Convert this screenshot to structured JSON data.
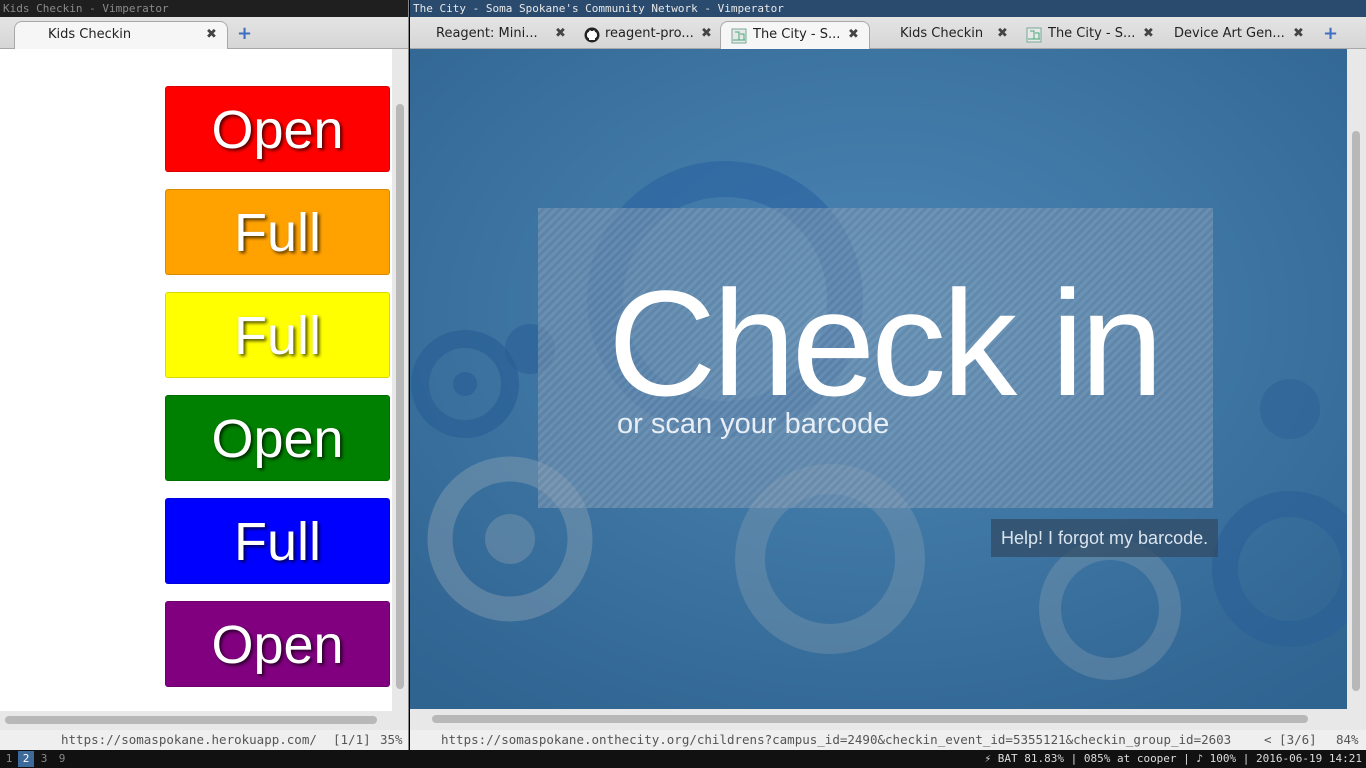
{
  "left_window": {
    "title": "Kids Checkin - Vimperator",
    "tabs": [
      {
        "label": "Kids Checkin"
      }
    ],
    "new_tab": "+",
    "close_glyph": "✖",
    "buttons": [
      {
        "label": "Open",
        "color": "#ff0000"
      },
      {
        "label": "Full",
        "color": "#ffa200"
      },
      {
        "label": "Full",
        "color": "#ffff00"
      },
      {
        "label": "Open",
        "color": "#008000"
      },
      {
        "label": "Full",
        "color": "#0000ff"
      },
      {
        "label": "Open",
        "color": "#800080"
      }
    ],
    "status": {
      "url": "https://somaspokane.herokuapp.com/",
      "position": "[1/1]",
      "zoom": "35%"
    }
  },
  "right_window": {
    "title": "The City - Soma Spokane's Community Network - Vimperator",
    "tabs": [
      {
        "label": "Reagent: Mini...",
        "icon": "none"
      },
      {
        "label": "reagent-pro...",
        "icon": "github-icon"
      },
      {
        "label": "The City - S...",
        "icon": "thecity-icon"
      },
      {
        "label": "Kids Checkin",
        "icon": "none"
      },
      {
        "label": "The City - S...",
        "icon": "thecity-icon"
      },
      {
        "label": "Device Art Gen...",
        "icon": "none"
      }
    ],
    "active_tab": 2,
    "new_tab": "+",
    "close_glyph": "✖",
    "page": {
      "heading": "Check in",
      "subheading": "or scan your barcode",
      "help_link": "Help! I forgot my barcode."
    },
    "status": {
      "url": "https://somaspokane.onthecity.org/childrens?campus_id=2490&checkin_event_id=5355121&checkin_group_id=2603",
      "position": "< [3/6]",
      "zoom": "84%"
    }
  },
  "taskbar": {
    "workspaces": [
      "1",
      "2",
      "3",
      "9"
    ],
    "active_workspace": "2",
    "info": "⚡ BAT 81.83% | 085% at cooper | ♪ 100% | 2016-06-19 14:21"
  },
  "colors": {
    "accent": "#3d6a9a",
    "page_bg": "#3b72a0"
  }
}
